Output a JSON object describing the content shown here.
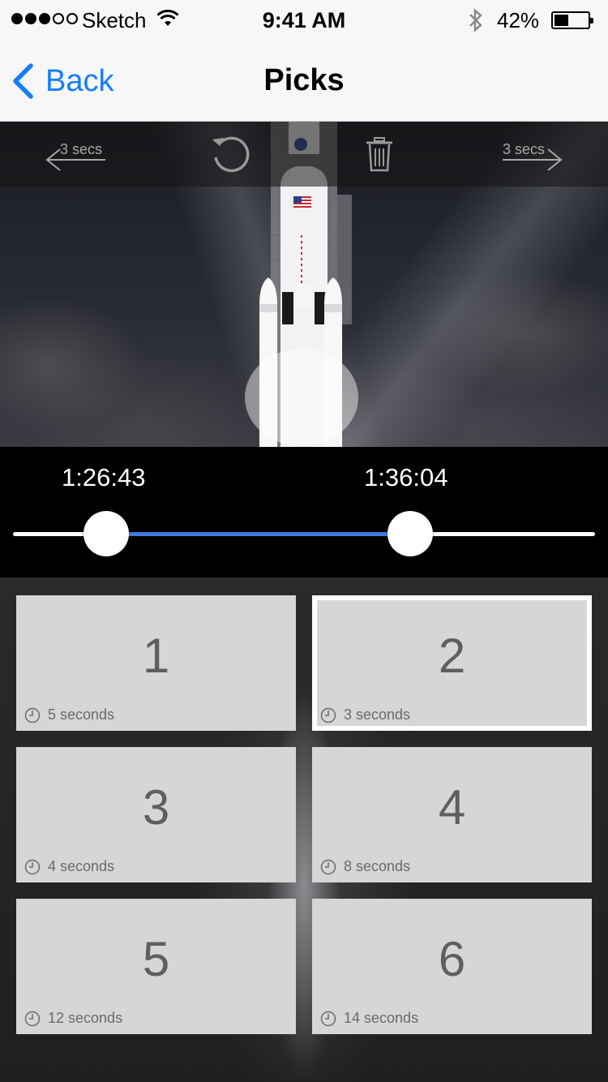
{
  "status": {
    "carrier": "Sketch",
    "time": "9:41 AM",
    "battery_pct": "42%",
    "battery_level": 0.42,
    "signal_bars": 3,
    "signal_total": 5
  },
  "nav": {
    "back_label": "Back",
    "title": "Picks"
  },
  "toolbar": {
    "rewind_label": "3 secs",
    "forward_label": "3 secs",
    "icons": [
      "left-arrow-icon",
      "undo-icon",
      "trash-icon",
      "right-arrow-icon"
    ]
  },
  "scrubber": {
    "start_time": "1:26:43",
    "end_time": "1:36:04",
    "range_color": "#3f7be0"
  },
  "picks": [
    {
      "number": "1",
      "duration": "5 seconds",
      "selected": false
    },
    {
      "number": "2",
      "duration": "3 seconds",
      "selected": true
    },
    {
      "number": "3",
      "duration": "4 seconds",
      "selected": false
    },
    {
      "number": "4",
      "duration": "8 seconds",
      "selected": false
    },
    {
      "number": "5",
      "duration": "12 seconds",
      "selected": false
    },
    {
      "number": "6",
      "duration": "14 seconds",
      "selected": false
    }
  ],
  "colors": {
    "accent": "#157efb",
    "tile": "#d6d6d6"
  }
}
